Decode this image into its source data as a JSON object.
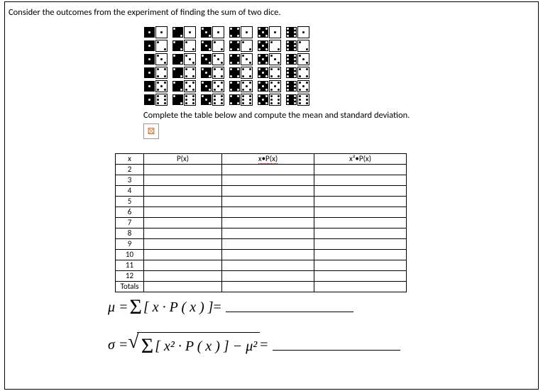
{
  "prompt": "Consider the outcomes from the experiment of finding the sum of two dice.",
  "instruction": "Complete the table below and compute the mean and standard deviation.",
  "placeholder_icon": "⚄",
  "table": {
    "headers": {
      "c1": "x",
      "c2": "P(x)",
      "c3": "x•P(x)",
      "c4": "x²•P(x)"
    },
    "rows": [
      "2",
      "3",
      "4",
      "5",
      "6",
      "7",
      "8",
      "9",
      "10",
      "11",
      "12",
      "Totals"
    ]
  },
  "formulas": {
    "mu_lhs": "μ = ",
    "mu_sum": "Σ",
    "mu_body": "[ x · P ( x ) ]",
    "equals": " = ",
    "sigma_lhs": "σ = ",
    "sigma_sum": "Σ",
    "sigma_body": "[ x² · P ( x ) ] − μ²"
  },
  "dice_grid": [
    [
      [
        1,
        1
      ],
      [
        2,
        1
      ],
      [
        3,
        1
      ],
      [
        4,
        1
      ],
      [
        5,
        1
      ],
      [
        6,
        1
      ]
    ],
    [
      [
        1,
        2
      ],
      [
        2,
        2
      ],
      [
        3,
        2
      ],
      [
        4,
        2
      ],
      [
        5,
        2
      ],
      [
        6,
        2
      ]
    ],
    [
      [
        1,
        3
      ],
      [
        2,
        3
      ],
      [
        3,
        3
      ],
      [
        4,
        3
      ],
      [
        5,
        3
      ],
      [
        6,
        3
      ]
    ],
    [
      [
        1,
        4
      ],
      [
        2,
        4
      ],
      [
        3,
        4
      ],
      [
        4,
        4
      ],
      [
        5,
        4
      ],
      [
        6,
        4
      ]
    ],
    [
      [
        1,
        5
      ],
      [
        2,
        5
      ],
      [
        3,
        5
      ],
      [
        4,
        5
      ],
      [
        5,
        5
      ],
      [
        6,
        5
      ]
    ],
    [
      [
        1,
        6
      ],
      [
        2,
        6
      ],
      [
        3,
        6
      ],
      [
        4,
        6
      ],
      [
        5,
        6
      ],
      [
        6,
        6
      ]
    ]
  ]
}
